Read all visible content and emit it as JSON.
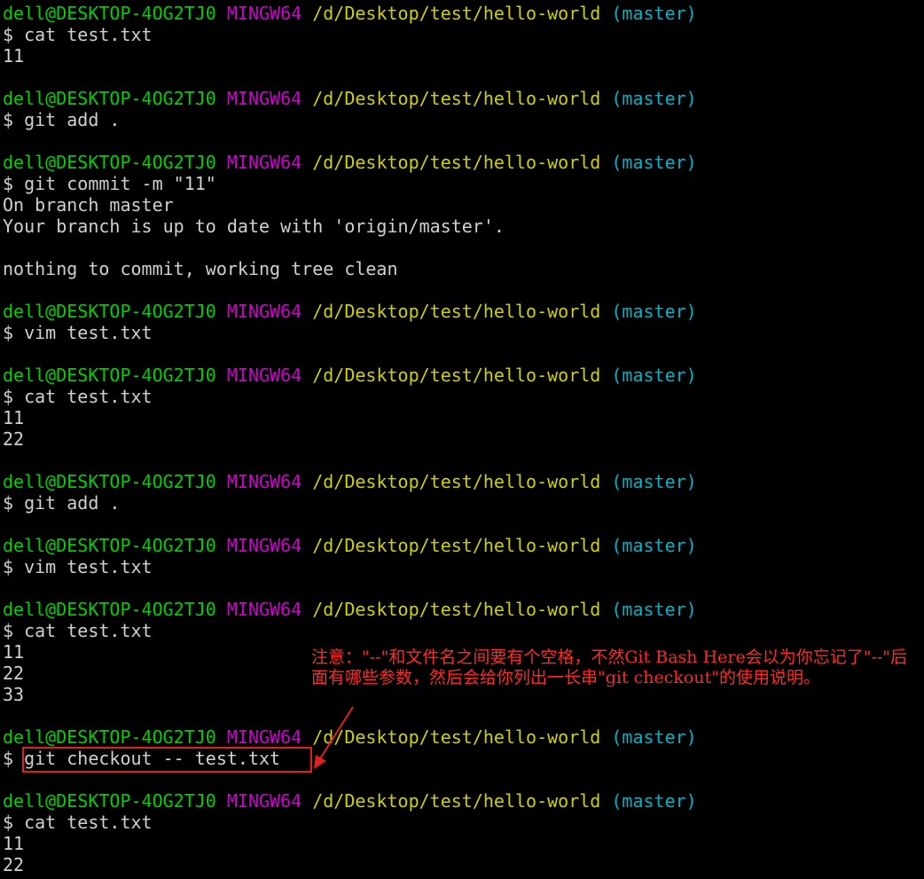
{
  "terminal": {
    "colors": {
      "user_host": "#00d000",
      "system": "#d000d0",
      "path": "#d0d000",
      "branch": "#00b4c8",
      "output": "#d0d0d0",
      "annotation": "#ff2a2a"
    },
    "prompt": {
      "user_host": "dell@DESKTOP-4OG2TJ0",
      "system": "MINGW64",
      "path": "/d/Desktop/test/hello-world",
      "branch": "(master)"
    },
    "lines": [
      {
        "type": "prompt"
      },
      {
        "type": "command",
        "text": "$ cat test.txt"
      },
      {
        "type": "output",
        "text": "11"
      },
      {
        "type": "blank"
      },
      {
        "type": "prompt"
      },
      {
        "type": "command",
        "text": "$ git add ."
      },
      {
        "type": "blank"
      },
      {
        "type": "prompt"
      },
      {
        "type": "command",
        "text": "$ git commit -m \"11\""
      },
      {
        "type": "output",
        "text": "On branch master"
      },
      {
        "type": "output",
        "text": "Your branch is up to date with 'origin/master'."
      },
      {
        "type": "blank"
      },
      {
        "type": "output",
        "text": "nothing to commit, working tree clean"
      },
      {
        "type": "blank"
      },
      {
        "type": "prompt"
      },
      {
        "type": "command",
        "text": "$ vim test.txt"
      },
      {
        "type": "blank"
      },
      {
        "type": "prompt"
      },
      {
        "type": "command",
        "text": "$ cat test.txt"
      },
      {
        "type": "output",
        "text": "11"
      },
      {
        "type": "output",
        "text": "22"
      },
      {
        "type": "blank"
      },
      {
        "type": "prompt"
      },
      {
        "type": "command",
        "text": "$ git add ."
      },
      {
        "type": "blank"
      },
      {
        "type": "prompt"
      },
      {
        "type": "command",
        "text": "$ vim test.txt"
      },
      {
        "type": "blank"
      },
      {
        "type": "prompt"
      },
      {
        "type": "command",
        "text": "$ cat test.txt"
      },
      {
        "type": "output",
        "text": "11"
      },
      {
        "type": "output",
        "text": "22"
      },
      {
        "type": "output",
        "text": "33"
      },
      {
        "type": "blank"
      },
      {
        "type": "prompt"
      },
      {
        "type": "command",
        "text": "$ git checkout -- test.txt"
      },
      {
        "type": "blank"
      },
      {
        "type": "prompt"
      },
      {
        "type": "command",
        "text": "$ cat test.txt"
      },
      {
        "type": "output",
        "text": "11"
      },
      {
        "type": "output",
        "text": "22"
      }
    ]
  },
  "annotation": {
    "text": "注意：\"--\"和文件名之间要有个空格，不然Git Bash Here会以为你忘记了\"--\"后面有哪些参数，然后会给你列出一长串\"git checkout\"的使用说明。"
  }
}
